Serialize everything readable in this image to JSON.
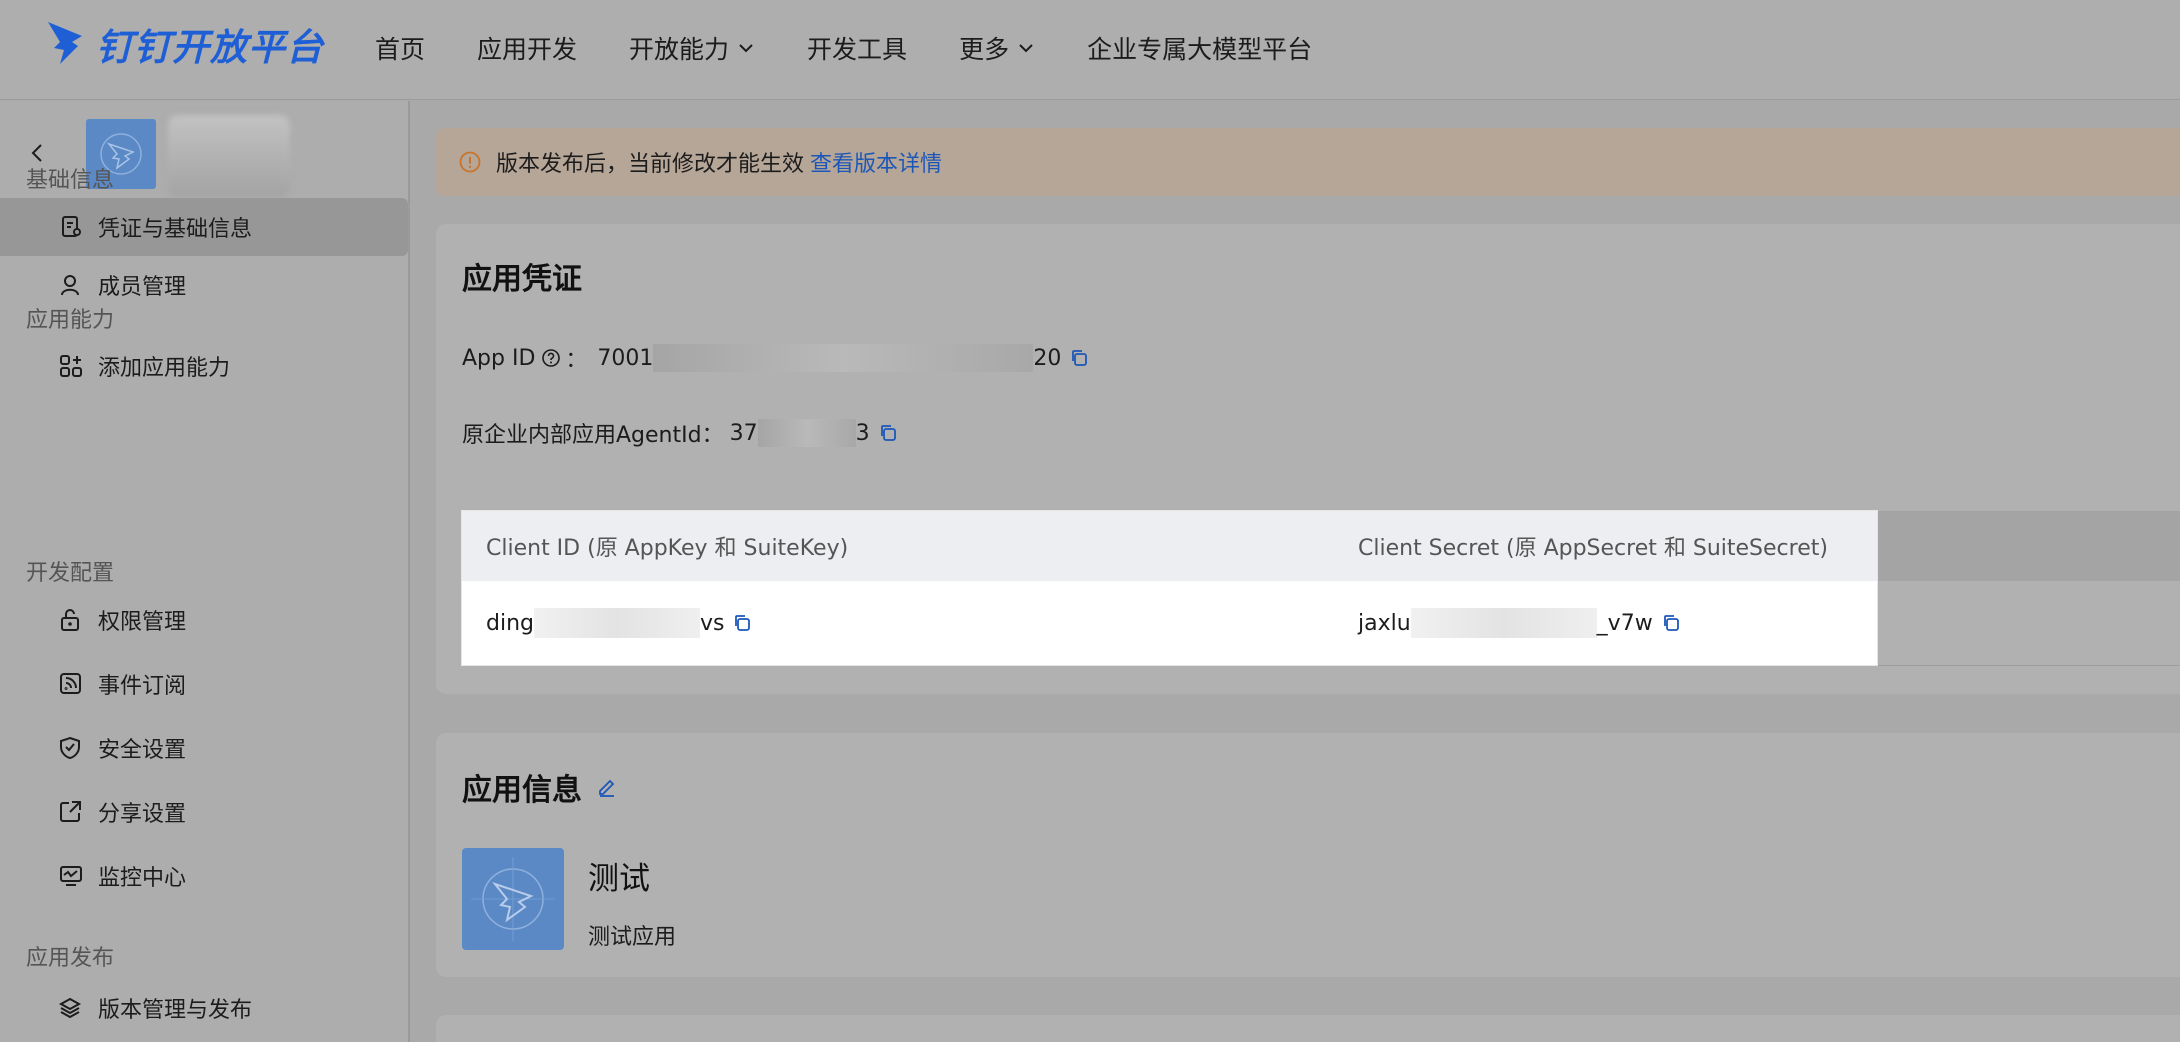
{
  "header": {
    "logo_text": "钉钉开放平台",
    "nav": [
      {
        "label": "首页"
      },
      {
        "label": "应用开发"
      },
      {
        "label": "开放能力"
      },
      {
        "label": "开发工具"
      },
      {
        "label": "更多"
      },
      {
        "label": "企业专属大模型平台"
      }
    ]
  },
  "sidebar": {
    "groups": [
      {
        "label": "基础信息"
      },
      {
        "label": "应用能力"
      },
      {
        "label": "开发配置"
      },
      {
        "label": "应用发布"
      }
    ],
    "items": [
      {
        "label": "凭证与基础信息",
        "icon": "credential-icon"
      },
      {
        "label": "成员管理",
        "icon": "user-icon"
      },
      {
        "label": "添加应用能力",
        "icon": "grid-plus-icon"
      },
      {
        "label": "权限管理",
        "icon": "lock-icon"
      },
      {
        "label": "事件订阅",
        "icon": "rss-icon"
      },
      {
        "label": "安全设置",
        "icon": "shield-icon"
      },
      {
        "label": "分享设置",
        "icon": "share-icon"
      },
      {
        "label": "监控中心",
        "icon": "monitor-icon"
      },
      {
        "label": "版本管理与发布",
        "icon": "layers-icon"
      }
    ]
  },
  "banner": {
    "text": "版本发布后，当前修改才能生效",
    "link": "查看版本详情"
  },
  "credentials": {
    "title": "应用凭证",
    "app_id_label": "App ID",
    "app_id_sep": "：",
    "app_id_prefix": "7001",
    "app_id_suffix": "20",
    "agent_label": "原企业内部应用AgentId：",
    "agent_prefix": "37",
    "agent_suffix": "3",
    "client_id_header": "Client ID (原 AppKey 和 SuiteKey)",
    "client_secret_header": "Client Secret (原 AppSecret 和 SuiteSecret)",
    "client_id_prefix": "ding",
    "client_id_suffix": "vs",
    "client_secret_prefix": "jaxlu",
    "client_secret_suffix": "_v7w"
  },
  "app_info": {
    "title": "应用信息",
    "name": "测试",
    "description": "测试应用"
  },
  "colors": {
    "brand": "#1f5fd6",
    "link": "#1c57b8",
    "warning": "#c8742a"
  }
}
